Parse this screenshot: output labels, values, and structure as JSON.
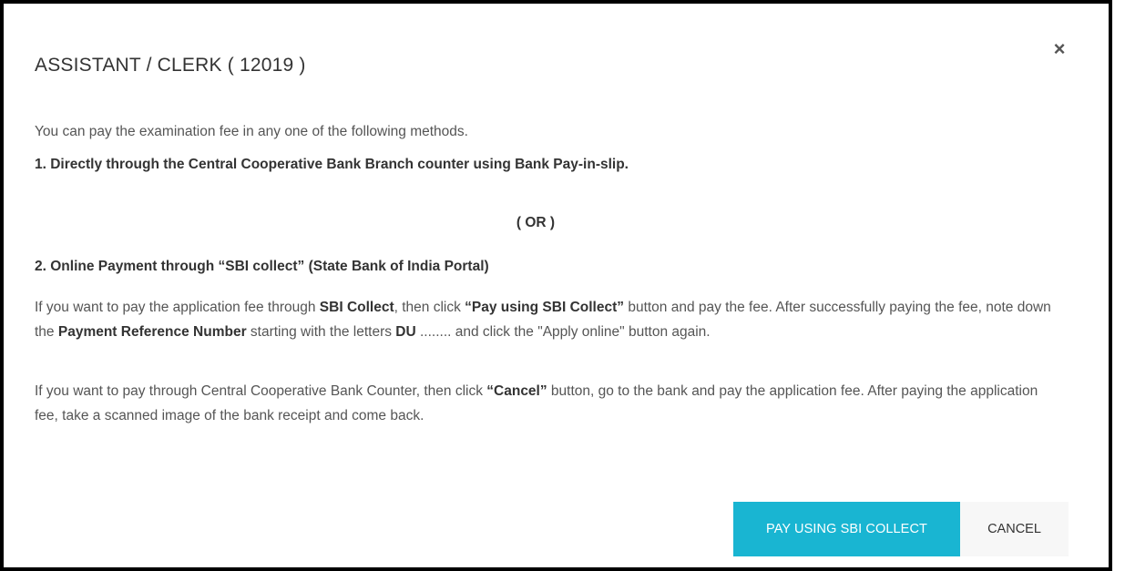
{
  "modal": {
    "title": "ASSISTANT / CLERK ( 12019 )",
    "close_glyph": "×",
    "intro": "You can pay the examination fee in any one of the following methods.",
    "method1": "1. Directly through the Central Cooperative Bank Branch counter using Bank Pay-in-slip.",
    "or_text": "( OR )",
    "method2": "2. Online Payment through “SBI collect” (State Bank of India Portal)",
    "info1": {
      "part1": "If you want to pay the application fee through ",
      "bold1": "SBI Collect",
      "part2": ", then click ",
      "bold2": "“Pay using SBI Collect”",
      "part3": " button and pay the fee. After successfully paying the fee, note down the  ",
      "bold3": "Payment Reference Number",
      "part4": " starting with the letters ",
      "bold4": "DU",
      "part5": " ........ and click the \"Apply online\" button again."
    },
    "info2": {
      "part1": "If you want to pay through Central Cooperative Bank Counter, then click ",
      "bold1": "“Cancel”",
      "part2": " button, go to the bank and pay the application fee. After paying the application fee, take a scanned image of the bank receipt and come back."
    },
    "buttons": {
      "pay_label": "PAY USING SBI COLLECT",
      "cancel_label": "CANCEL"
    }
  },
  "colors": {
    "pay_button": "#19b5d2",
    "cancel_button": "#f7f7f7",
    "border": "#000000"
  }
}
